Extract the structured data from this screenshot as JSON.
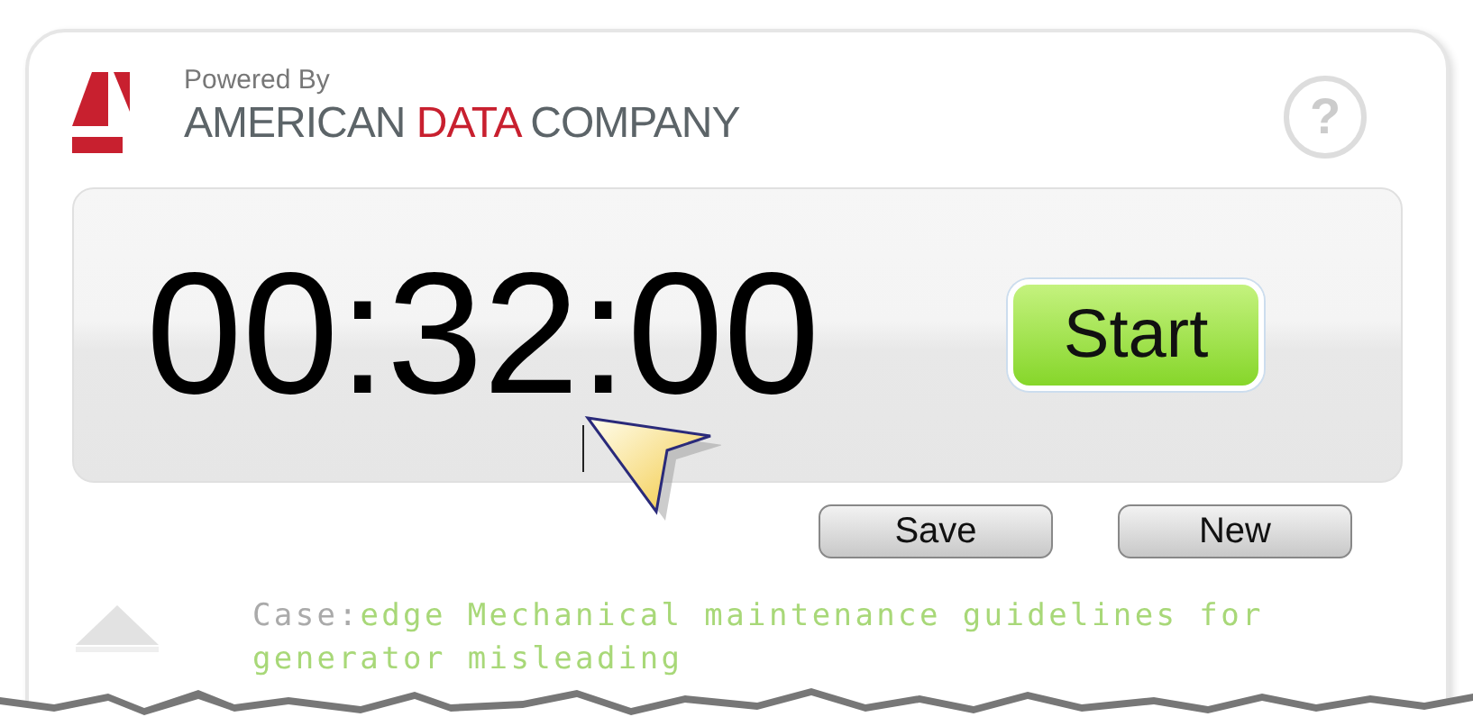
{
  "brand": {
    "powered_by": "Powered By",
    "company": [
      {
        "text": "AMERICAN",
        "highlight": false
      },
      {
        "text": "DATA",
        "highlight": true
      },
      {
        "text": "COMPANY",
        "highlight": false
      }
    ]
  },
  "help": {
    "label": "?"
  },
  "timer": {
    "time": "00:32:00"
  },
  "buttons": [
    {
      "label": "Start",
      "kind": "primary"
    },
    {
      "label": "Save",
      "kind": "secondary"
    },
    {
      "label": "New",
      "kind": "secondary"
    }
  ],
  "case": {
    "label": "Case:",
    "title": "edge Mechanical maintenance guidelines for generator misleading"
  }
}
